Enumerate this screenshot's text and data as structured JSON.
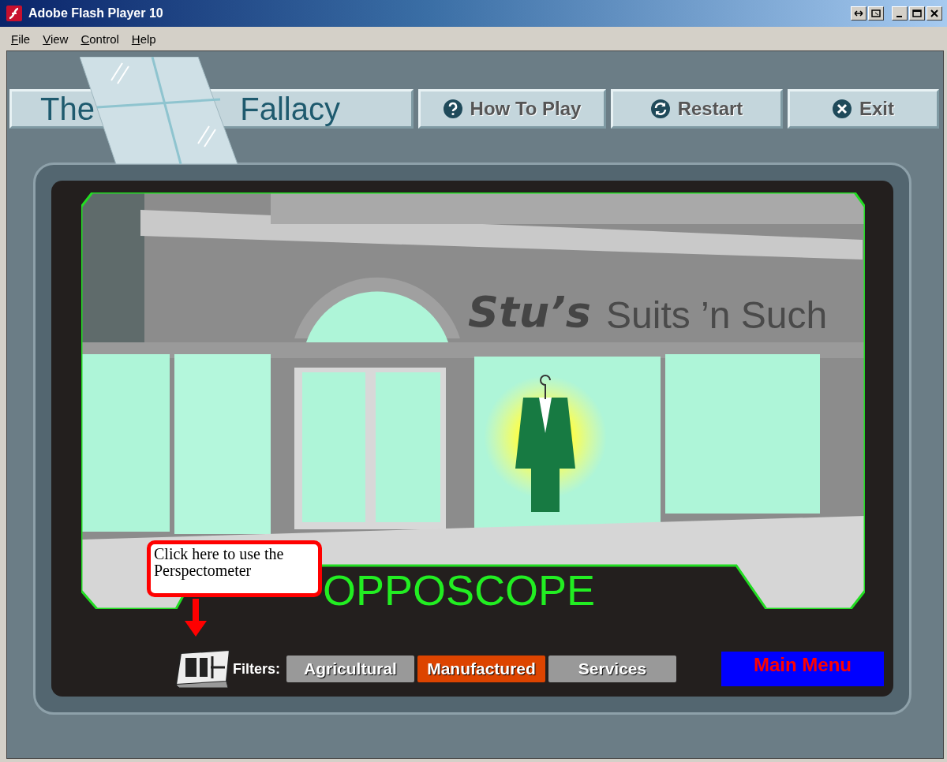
{
  "window": {
    "title": "Adobe Flash Player 10"
  },
  "menu": [
    {
      "label": "File"
    },
    {
      "label": "View"
    },
    {
      "label": "Control"
    },
    {
      "label": "Help"
    }
  ],
  "header": {
    "title_left": "The",
    "title_right": "Fallacy",
    "buttons": [
      {
        "label": "How To Play",
        "kind": "help"
      },
      {
        "label": "Restart",
        "kind": "restart"
      },
      {
        "label": "Exit",
        "kind": "exit"
      }
    ]
  },
  "scene": {
    "sign_bold": "Stu’s",
    "sign": "Suits ’n Such"
  },
  "scope_title": "OPPOSCOPE",
  "callout": "Click here to use the Perspectometer",
  "filters": {
    "label": "Filters:",
    "items": [
      {
        "label": "Agricultural",
        "selected": false
      },
      {
        "label": "Manufactured",
        "selected": true
      },
      {
        "label": "Services",
        "selected": false
      }
    ]
  },
  "main_menu": "Main Menu"
}
